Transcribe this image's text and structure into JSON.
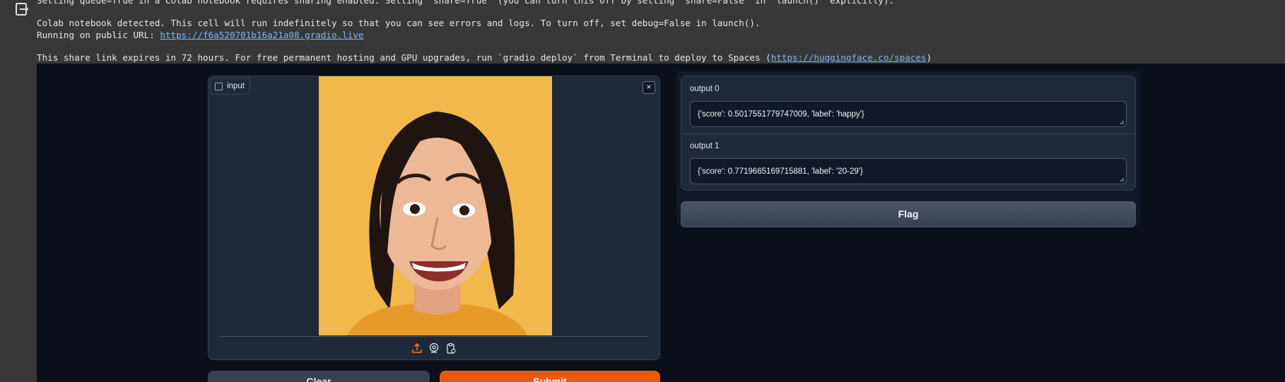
{
  "console": {
    "line_partial": "Setting queue=True in a Colab notebook requires sharing enabled. Setting `share=True` (you can turn this off by setting `share=False` in `launch()` explicitly).",
    "line_colab": "Colab notebook detected. This cell will run indefinitely so that you can see errors and logs. To turn off, set debug=False in launch().",
    "public_url_prefix": "Running on public URL: ",
    "public_url": "https://f6a520701b16a21a08.gradio.live",
    "share_prefix": "This share link expires in 72 hours. For free permanent hosting and GPU upgrades, run `gradio deploy` from Terminal to deploy to Spaces (",
    "share_link": "https://huggingface.co/spaces",
    "share_suffix": ")"
  },
  "input": {
    "label": "input",
    "close_symbol": "×",
    "icons": [
      "upload-icon",
      "webcam-icon",
      "clipboard-icon"
    ]
  },
  "buttons": {
    "clear": "Clear",
    "submit": "Submit",
    "flag": "Flag"
  },
  "outputs": [
    {
      "label": "output 0",
      "value": "{'score': 0.5017551779747009, 'label': 'happy'}"
    },
    {
      "label": "output 1",
      "value": "{'score': 0.7719665169715881, 'label': '20-29'}"
    }
  ],
  "colors": {
    "accent_orange": "#ea580c",
    "link_blue": "#7cb6f2",
    "photo_background": "#f2b84b"
  }
}
